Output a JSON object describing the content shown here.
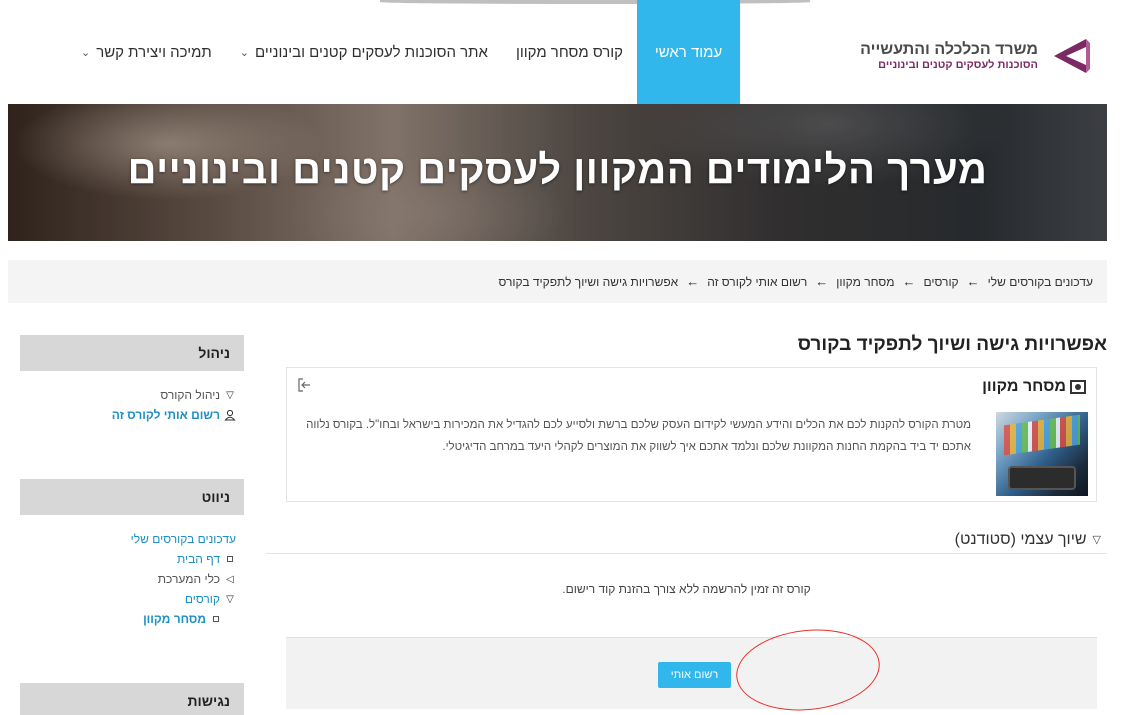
{
  "navbar": {
    "brand_title": "משרד הכלכלה והתעשייה",
    "brand_subtitle": "הסוכנות לעסקים קטנים ובינוניים",
    "items": [
      {
        "label": "עמוד ראשי",
        "active": true,
        "dropdown": false
      },
      {
        "label": "קורס מסחר מקוון",
        "active": false,
        "dropdown": false
      },
      {
        "label": "אתר הסוכנות לעסקים קטנים ובינוניים",
        "active": false,
        "dropdown": true
      },
      {
        "label": "תמיכה ויצירת קשר",
        "active": false,
        "dropdown": true
      }
    ],
    "accent_color": "#31b7ec",
    "brand_color": "#7c2a63"
  },
  "banner": {
    "title": "מערך הלימודים המקוון לעסקים קטנים ובינוניים"
  },
  "breadcrumb": {
    "items": [
      "עדכונים בקורסים שלי",
      "קורסים",
      "מסחר מקוון",
      "רשום אותי לקורס זה",
      "אפשרויות גישה ושיוך לתפקיד בקורס"
    ],
    "separator": "←"
  },
  "sidebar": {
    "admin": {
      "title": "ניהול",
      "items": [
        {
          "label": "ניהול הקורס",
          "marker": "▽"
        },
        {
          "label": "רשום אותי לקורס זה",
          "marker": "user-icon"
        }
      ]
    },
    "navigation": {
      "title": "ניווט",
      "items": [
        {
          "label": "עדכונים בקורסים שלי"
        },
        {
          "label": "דף הבית",
          "marker": "square"
        },
        {
          "label": "כלי המערכת",
          "marker": "◁"
        },
        {
          "label": "קורסים",
          "marker": "▽"
        },
        {
          "label": "מסחר מקוון",
          "marker": "square"
        }
      ]
    },
    "accessibility": {
      "title": "נגישות"
    }
  },
  "main": {
    "heading": "אפשרויות גישה ושיוך לתפקיד בקורס",
    "course": {
      "name": "מסחר מקוון",
      "summary": "מטרת הקורס להקנות לכם את הכלים והידע המעשי לקידום העסק שלכם ברשת ולסייע לכם להגדיל את המכירות בישראל ובחו\"ל. בקורס נלווה אתכם יד ביד בהקמת החנות המקוונת שלכם ונלמד אתכם איך לשווק את המוצרים לקהלי היעד במרחב הדיגיטלי."
    },
    "self_enrol": {
      "title": "שיוך עצמי (סטודנט)",
      "note": "קורס זה זמין להרשמה ללא צורך בהזנת קוד רישום.",
      "button_label": "רשום אותי"
    }
  },
  "annotation": {
    "color": "#e8302a"
  }
}
